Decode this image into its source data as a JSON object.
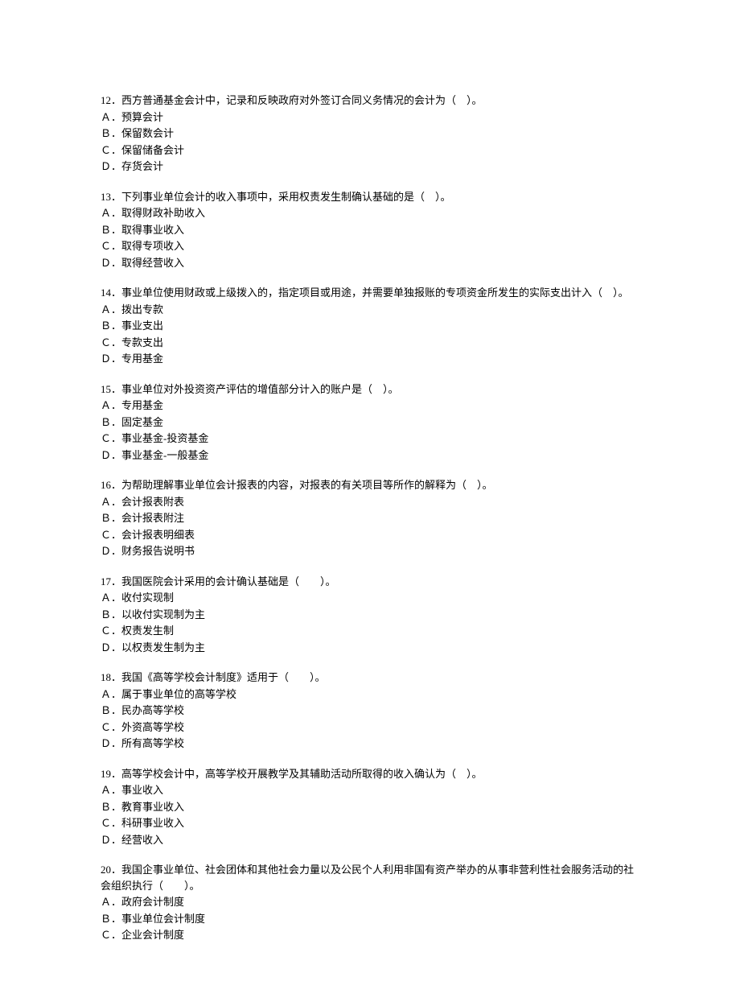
{
  "questions": [
    {
      "number": "12．",
      "text": "西方普通基金会计中，记录和反映政府对外签订合同义务情况的会计为（　）。",
      "options": [
        "Ａ．预算会计",
        "Ｂ．保留数会计",
        "Ｃ．保留储备会计",
        "Ｄ．存货会计"
      ]
    },
    {
      "number": "13．",
      "text": "下列事业单位会计的收入事项中，采用权责发生制确认基础的是（　）。",
      "options": [
        "Ａ．取得财政补助收入",
        "Ｂ．取得事业收入",
        "Ｃ．取得专项收入",
        "Ｄ．取得经营收入"
      ]
    },
    {
      "number": "14．",
      "text": "事业单位使用财政或上级拨入的，指定项目或用途，并需要单独报账的专项资金所发生的实际支出计入（　）。",
      "options": [
        "Ａ．拨出专款",
        "Ｂ．事业支出",
        "Ｃ．专款支出",
        "Ｄ．专用基金"
      ]
    },
    {
      "number": "15．",
      "text": "事业单位对外投资资产评估的增值部分计入的账户是（　）。",
      "options": [
        "Ａ．专用基金",
        "Ｂ．固定基金",
        "Ｃ．事业基金-投资基金",
        "Ｄ．事业基金-一般基金"
      ]
    },
    {
      "number": "16．",
      "text": "为帮助理解事业单位会计报表的内容，对报表的有关项目等所作的解释为（　）。",
      "options": [
        "Ａ．会计报表附表",
        "Ｂ．会计报表附注",
        "Ｃ．会计报表明细表",
        "Ｄ．财务报告说明书"
      ]
    },
    {
      "number": "17．",
      "text": "我国医院会计采用的会计确认基础是（　　）。",
      "options": [
        "Ａ．收付实现制",
        "Ｂ．以收付实现制为主",
        "Ｃ．权责发生制",
        "Ｄ．以权责发生制为主"
      ]
    },
    {
      "number": "18．",
      "text": "我国《高等学校会计制度》适用于（　　）。",
      "options": [
        "Ａ．属于事业单位的高等学校",
        "Ｂ．民办高等学校",
        "Ｃ．外资高等学校",
        "Ｄ．所有高等学校"
      ]
    },
    {
      "number": "19．",
      "text": "高等学校会计中，高等学校开展教学及其辅助活动所取得的收入确认为（　）。",
      "options": [
        "Ａ．事业收入",
        "Ｂ．教育事业收入",
        "Ｃ．科研事业收入",
        "Ｄ．经营收入"
      ]
    },
    {
      "number": "20．",
      "text": "我国企事业单位、社会团体和其他社会力量以及公民个人利用非国有资产举办的从事非营利性社会服务活动的社会组织执行（　　）。",
      "options": [
        "Ａ．政府会计制度",
        "Ｂ．事业单位会计制度",
        "Ｃ．企业会计制度"
      ]
    }
  ]
}
